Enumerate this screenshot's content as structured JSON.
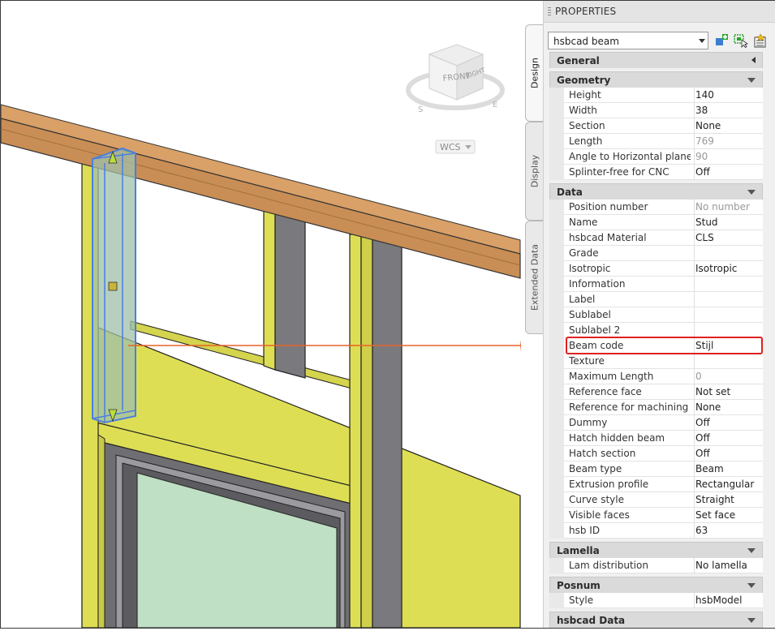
{
  "palette": {
    "title": "PROPERTIES",
    "object_type": "hsbcad beam",
    "tabs": [
      "Design",
      "Display",
      "Extended Data"
    ]
  },
  "viewcube": {
    "top_label": "FRONT",
    "right_label": "RIGHT",
    "compass_s": "S",
    "compass_e": "E",
    "wcs": "WCS"
  },
  "sections": [
    {
      "title": "General",
      "collapsed": true,
      "rows": []
    },
    {
      "title": "Geometry",
      "rows": [
        {
          "name": "Height",
          "value": "140"
        },
        {
          "name": "Width",
          "value": "38"
        },
        {
          "name": "Section",
          "value": "None"
        },
        {
          "name": "Length",
          "value": "769",
          "disabled": true
        },
        {
          "name": "Angle to Horizontal plane",
          "value": "90",
          "disabled": true
        },
        {
          "name": "Splinter-free for CNC",
          "value": "Off"
        }
      ]
    },
    {
      "title": "Data",
      "rows": [
        {
          "name": "Position number",
          "value": "No number",
          "disabled": true
        },
        {
          "name": "Name",
          "value": "Stud"
        },
        {
          "name": "hsbcad Material",
          "value": "CLS"
        },
        {
          "name": "Grade",
          "value": ""
        },
        {
          "name": "Isotropic",
          "value": "Isotropic"
        },
        {
          "name": "Information",
          "value": ""
        },
        {
          "name": "Label",
          "value": ""
        },
        {
          "name": "Sublabel",
          "value": ""
        },
        {
          "name": "Sublabel 2",
          "value": ""
        },
        {
          "name": "Beam code",
          "value": "Stijl"
        },
        {
          "name": "Texture",
          "value": ""
        },
        {
          "name": "Maximum Length",
          "value": "0",
          "disabled": true
        },
        {
          "name": "Reference face",
          "value": "Not set"
        },
        {
          "name": "Reference for machining",
          "value": "None"
        },
        {
          "name": "Dummy",
          "value": "Off"
        },
        {
          "name": "Hatch hidden beam",
          "value": "Off"
        },
        {
          "name": "Hatch section",
          "value": "Off"
        },
        {
          "name": "Beam type",
          "value": "Beam"
        },
        {
          "name": "Extrusion profile",
          "value": "Rectangular"
        },
        {
          "name": "Curve style",
          "value": "Straight"
        },
        {
          "name": "Visible faces",
          "value": "Set face"
        },
        {
          "name": "hsb ID",
          "value": "63"
        }
      ]
    },
    {
      "title": "Lamella",
      "rows": [
        {
          "name": "Lam distribution",
          "value": "No lamella"
        }
      ]
    },
    {
      "title": "Posnum",
      "rows": [
        {
          "name": "Style",
          "value": "hsbModel"
        }
      ]
    },
    {
      "title": "hsbcad Data",
      "rows": []
    }
  ],
  "colors": {
    "timber": "#c98e55",
    "sheathing": "#dede55",
    "stud_dark": "#7a7a7e",
    "glass": "#bfe0c4",
    "selection": "#4a7fe0",
    "arrow": "#e8622a",
    "highlight": "#e02020"
  }
}
